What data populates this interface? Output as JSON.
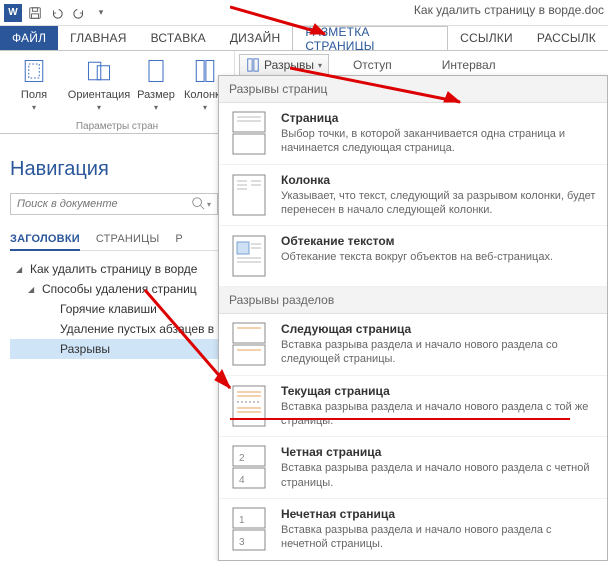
{
  "titlebar": {
    "doc_title": "Как удалить страницу в ворде.doc"
  },
  "tabs": {
    "file": "ФАЙЛ",
    "home": "ГЛАВНАЯ",
    "insert": "ВСТАВКА",
    "design": "ДИЗАЙН",
    "layout": "РАЗМЕТКА СТРАНИЦЫ",
    "references": "ССЫЛКИ",
    "mailings": "РАССЫЛК"
  },
  "ribbon": {
    "fields": "Поля",
    "orientation": "Ориентация",
    "size": "Размер",
    "columns": "Колонки",
    "page_setup_group": "Параметры стран",
    "breaks": "Разрывы",
    "indent": "Отступ",
    "interval": "Интервал"
  },
  "dropdown": {
    "section_pages": "Разрывы страниц",
    "section_sections": "Разрывы разделов",
    "items_pages": [
      {
        "title": "Страница",
        "desc": "Выбор точки, в которой заканчивается одна страница и начинается следующая страница."
      },
      {
        "title": "Колонка",
        "desc": "Указывает, что текст, следующий за разрывом колонки, будет перенесен в начало следующей колонки."
      },
      {
        "title": "Обтекание текстом",
        "desc": "Обтекание текста вокруг объектов на веб-страницах."
      }
    ],
    "items_sections": [
      {
        "title": "Следующая страница",
        "desc": "Вставка разрыва раздела и начало нового раздела со следующей страницы."
      },
      {
        "title": "Текущая страница",
        "desc": "Вставка разрыва раздела и начало нового раздела с той же страницы."
      },
      {
        "title": "Четная страница",
        "desc": "Вставка разрыва раздела и начало нового раздела с четной страницы."
      },
      {
        "title": "Нечетная страница",
        "desc": "Вставка разрыва раздела и начало нового раздела с нечетной страницы."
      }
    ]
  },
  "nav": {
    "title": "Навигация",
    "search_placeholder": "Поиск в документе",
    "tabs": {
      "headings": "ЗАГОЛОВКИ",
      "pages": "СТРАНИЦЫ",
      "results": "Р"
    },
    "tree": {
      "root": "Как удалить страницу в ворде",
      "lvl2": "Способы удаления страниц",
      "items": [
        "Горячие клавиши",
        "Удаление пустых абзацев в",
        "Разрывы"
      ]
    }
  }
}
